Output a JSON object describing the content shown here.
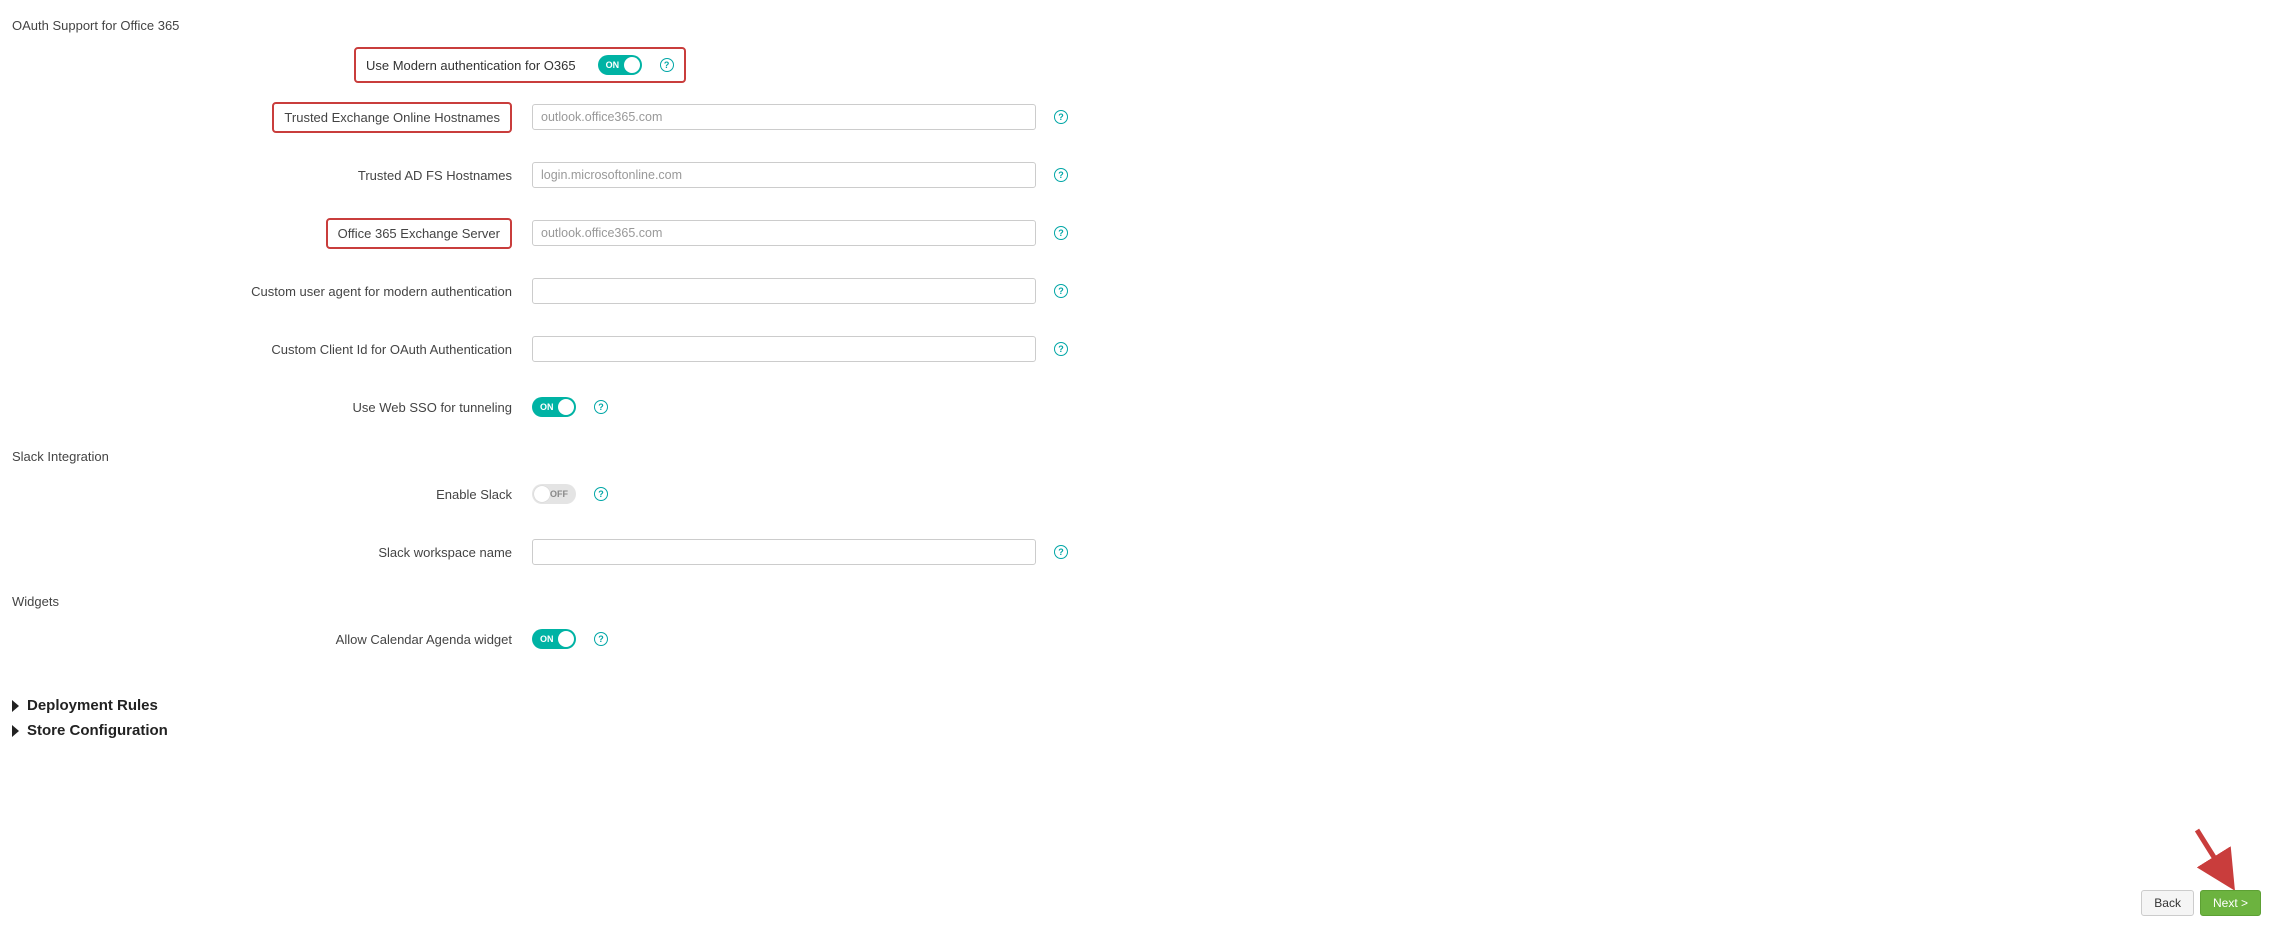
{
  "sections": {
    "oauth": {
      "title": "OAuth Support for Office 365",
      "modern_auth": {
        "label": "Use Modern authentication for O365",
        "state": "ON"
      },
      "trusted_exchange": {
        "label": "Trusted Exchange Online Hostnames",
        "placeholder": "outlook.office365.com",
        "value": ""
      },
      "trusted_adfs": {
        "label": "Trusted AD FS Hostnames",
        "placeholder": "login.microsoftonline.com",
        "value": ""
      },
      "o365_exchange_server": {
        "label": "Office 365 Exchange Server",
        "placeholder": "outlook.office365.com",
        "value": ""
      },
      "custom_user_agent": {
        "label": "Custom user agent for modern authentication",
        "placeholder": "",
        "value": ""
      },
      "custom_client_id": {
        "label": "Custom Client Id for OAuth Authentication",
        "placeholder": "",
        "value": ""
      },
      "web_sso": {
        "label": "Use Web SSO for tunneling",
        "state": "ON"
      }
    },
    "slack": {
      "title": "Slack Integration",
      "enable_slack": {
        "label": "Enable Slack",
        "state": "OFF"
      },
      "workspace_name": {
        "label": "Slack workspace name",
        "placeholder": "",
        "value": ""
      }
    },
    "widgets": {
      "title": "Widgets",
      "calendar_agenda": {
        "label": "Allow Calendar Agenda widget",
        "state": "ON"
      }
    }
  },
  "expandables": {
    "deployment_rules": "Deployment Rules",
    "store_configuration": "Store Configuration"
  },
  "footer": {
    "back": "Back",
    "next": "Next >"
  },
  "toggle_labels": {
    "on": "ON",
    "off": "OFF"
  }
}
